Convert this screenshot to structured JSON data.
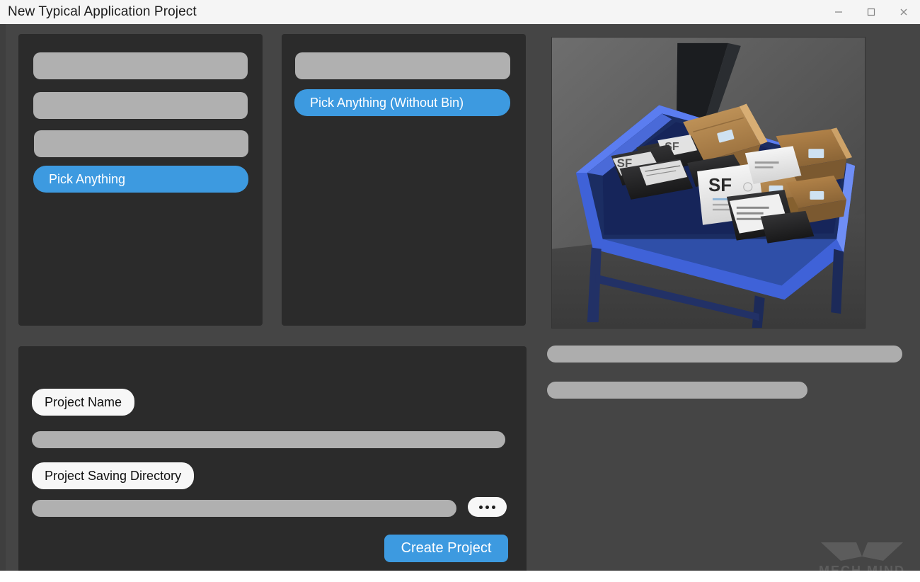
{
  "window": {
    "title": "New Typical Application Project",
    "controls": [
      {
        "name": "minimize",
        "glyph": "minimize-icon"
      },
      {
        "name": "maximize",
        "glyph": "maximize-icon"
      },
      {
        "name": "close",
        "glyph": "close-icon"
      }
    ]
  },
  "colors": {
    "titlebar_bg": "#f5f5f5",
    "page_bg": "#454545",
    "card_bg": "#2b2b2b",
    "accent_blue": "#3d9ae0",
    "redacted_gray": "#b0b0b0",
    "label_pill_bg": "#f7f7f7",
    "text_light": "#ffffff",
    "text_dark": "#111111"
  },
  "category_list": {
    "placeholder_rows": 3,
    "selected_item": "Pick Anything"
  },
  "application_list": {
    "placeholder_rows": 1,
    "selected_item": "Pick Anything (Without Bin)"
  },
  "preview": {
    "alt": "3D render of a blue parcel bin on a stand filled with cardboard boxes, black poly mailers and white envelopes"
  },
  "side_info": {
    "placeholder_rows": 2
  },
  "form": {
    "project_name_label": "Project Name",
    "project_name_value": "",
    "project_name_placeholder": "",
    "saving_directory_label": "Project Saving Directory",
    "saving_directory_value": "",
    "saving_directory_placeholder": "",
    "browse_label": "•••",
    "create_label": "Create Project"
  },
  "watermark": {
    "text": "MECH MIND"
  }
}
